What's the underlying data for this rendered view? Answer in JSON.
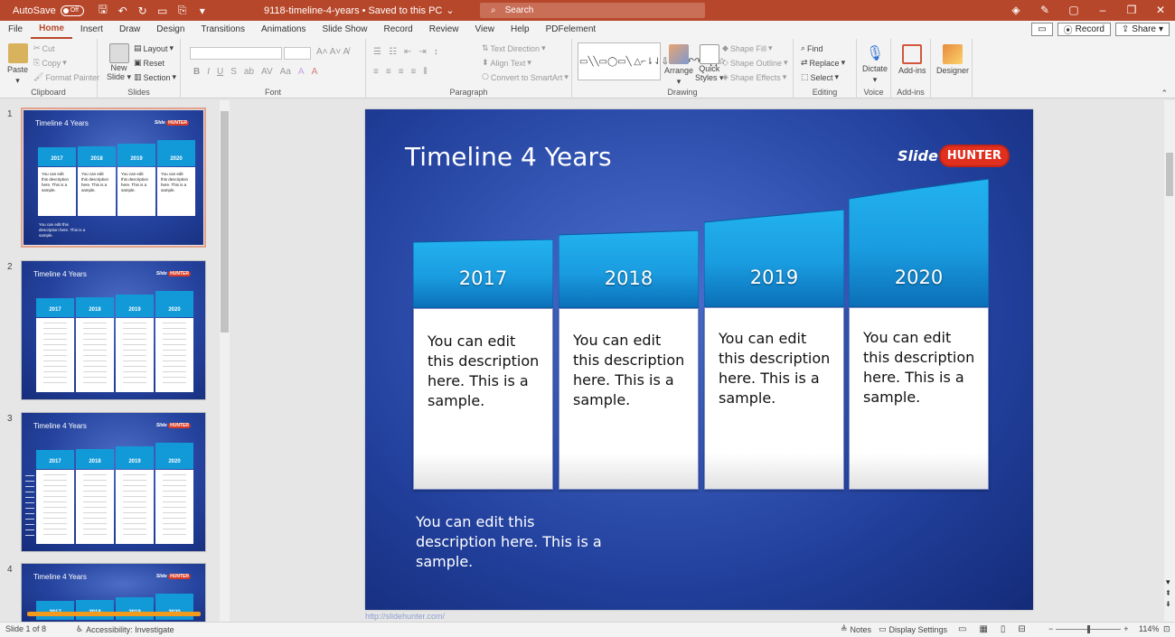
{
  "titlebar": {
    "autosave_label": "AutoSave",
    "autosave_state": "Off",
    "filename": "9118-timeline-4-years",
    "saved_status": "Saved to this PC",
    "search_placeholder": "Search",
    "accent_color": "#b7472a"
  },
  "menu": {
    "tabs": [
      "File",
      "Home",
      "Insert",
      "Draw",
      "Design",
      "Transitions",
      "Animations",
      "Slide Show",
      "Record",
      "Review",
      "View",
      "Help",
      "PDFelement"
    ],
    "active_tab": "Home",
    "record_button": "Record",
    "share_button": "Share"
  },
  "ribbon": {
    "clipboard": {
      "paste": "Paste",
      "cut": "Cut",
      "copy": "Copy",
      "format_painter": "Format Painter",
      "label": "Clipboard"
    },
    "slides": {
      "new_slide_1": "New",
      "new_slide_2": "Slide",
      "layout": "Layout",
      "reset": "Reset",
      "section": "Section",
      "label": "Slides"
    },
    "font": {
      "label": "Font"
    },
    "paragraph": {
      "text_direction": "Text Direction",
      "align_text": "Align Text",
      "convert_smartart": "Convert to SmartArt",
      "label": "Paragraph"
    },
    "drawing": {
      "arrange": "Arrange",
      "quick_styles_1": "Quick",
      "quick_styles_2": "Styles",
      "shape_fill": "Shape Fill",
      "shape_outline": "Shape Outline",
      "shape_effects": "Shape Effects",
      "label": "Drawing"
    },
    "editing": {
      "find": "Find",
      "replace": "Replace",
      "select": "Select",
      "label": "Editing"
    },
    "voice": {
      "dictate": "Dictate",
      "label": "Voice"
    },
    "addins": {
      "addins": "Add-ins",
      "label": "Add-ins"
    },
    "designer": {
      "designer": "Designer"
    }
  },
  "thumbnails": [
    {
      "num": "1",
      "title": "Timeline 4 Years"
    },
    {
      "num": "2",
      "title": "Timeline 4 Years"
    },
    {
      "num": "3",
      "title": "Timeline 4 Years"
    },
    {
      "num": "4",
      "title": "Timeline 4 Years"
    }
  ],
  "slide": {
    "title": "Timeline 4 Years",
    "logo_slide": "Slide",
    "logo_hunter": "HUNTER",
    "columns": [
      {
        "year": "2017",
        "text": [
          "You can edit",
          "this description",
          "here. This is a",
          "sample."
        ]
      },
      {
        "year": "2018",
        "text": [
          "You can edit",
          "this description",
          "here. This is a",
          "sample."
        ]
      },
      {
        "year": "2019",
        "text": [
          "You can edit",
          "this description",
          "here. This is a",
          "sample."
        ]
      },
      {
        "year": "2020",
        "text": [
          "You can edit",
          "this description",
          "here. This is a",
          "sample."
        ]
      }
    ],
    "footer_text": [
      "You can edit this",
      "description here. This is a",
      "sample."
    ],
    "url": "http://slidehunter.com/"
  },
  "status": {
    "slide_count": "Slide 1 of 8",
    "accessibility": "Accessibility: Investigate",
    "notes": "Notes",
    "display_settings": "Display Settings",
    "zoom": "114%"
  }
}
